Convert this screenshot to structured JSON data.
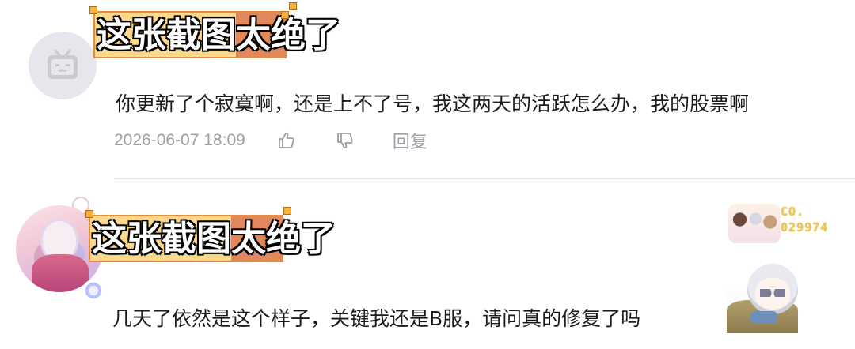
{
  "overlay_caption": "这张截图太绝了",
  "comments": [
    {
      "text": "你更新了个寂寞啊，还是上不了号，我这两天的活跃怎么办，我的股票啊",
      "time": "2026-06-07 18:09",
      "reply_label": "回复",
      "avatar": "default-tv-avatar",
      "like_icon": "thumbs-up-icon",
      "dislike_icon": "thumbs-down-icon"
    },
    {
      "text": "几天了依然是这个样子，关键我还是B服，请问真的修复了吗",
      "avatar": "anime-girl-avatar",
      "fan_badge": {
        "line1": "CO.",
        "line2": "029974"
      }
    }
  ],
  "colors": {
    "caption_left_bg": "#fcd98c",
    "caption_right_bg": "#e1895c",
    "meta_gray": "#9aa0a6",
    "fan_number": "#f2c64a"
  }
}
